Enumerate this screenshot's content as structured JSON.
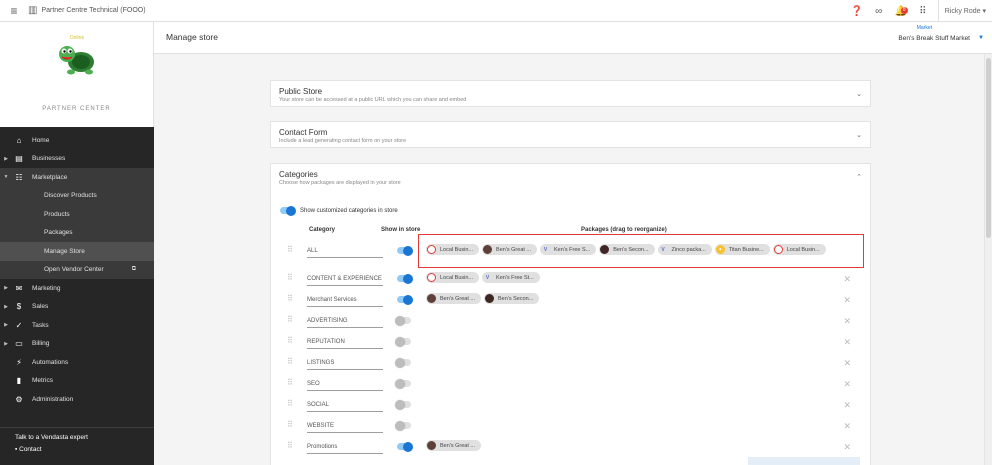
{
  "topbar": {
    "org_title": "Partner Centre Technical (FOOO)",
    "notifications_count": "8",
    "user_name": "Ricky Rode"
  },
  "sidebar": {
    "brand_text": "PARTNER CENTER",
    "logo_text": "Online",
    "items": [
      {
        "label": "Home",
        "icon": "home-icon"
      },
      {
        "label": "Businesses",
        "icon": "businesses-icon"
      },
      {
        "label": "Marketplace",
        "icon": "grid-icon"
      }
    ],
    "marketplace_sub": [
      {
        "label": "Discover Products"
      },
      {
        "label": "Products"
      },
      {
        "label": "Packages"
      },
      {
        "label": "Manage Store"
      },
      {
        "label": "Open Vendor Center"
      }
    ],
    "items_after": [
      {
        "label": "Marketing",
        "icon": "mail-icon"
      },
      {
        "label": "Sales",
        "icon": "dollar-icon"
      },
      {
        "label": "Tasks",
        "icon": "check-circle-icon"
      },
      {
        "label": "Billing",
        "icon": "billing-icon"
      },
      {
        "label": "Automations",
        "icon": "automation-icon"
      },
      {
        "label": "Metrics",
        "icon": "bar-chart-icon"
      },
      {
        "label": "Administration",
        "icon": "gear-icon"
      }
    ],
    "footer": {
      "expert": "Talk to a Vendasta expert",
      "contact": "Contact"
    }
  },
  "header": {
    "title": "Manage store",
    "market_label": "Market",
    "market_value": "Ben's Break Stuff Market"
  },
  "panels": {
    "public_store": {
      "title": "Public Store",
      "subtitle": "Your store can be accessed at a public URL which you can share and embed"
    },
    "contact_form": {
      "title": "Contact Form",
      "subtitle": "Include a lead generating contact form on your store"
    },
    "categories": {
      "title": "Categories",
      "subtitle": "Choose how packages are displayed in your store",
      "show_custom_label": "Show customized categories in store",
      "col_category": "Category",
      "col_show": "Show in store",
      "col_packages": "Packages (drag to reorganize)",
      "rows": [
        {
          "name": "ALL",
          "on": true,
          "chips": [
            {
              "label": "Local Busin...",
              "icon": "red"
            },
            {
              "label": "Ben's Great ...",
              "icon": "dark"
            },
            {
              "label": "Ken's Free S...",
              "icon": "v"
            },
            {
              "label": "Ben's Secon...",
              "icon": "dark2"
            },
            {
              "label": "Zinco packa...",
              "icon": "v"
            },
            {
              "label": "Titan Busine...",
              "icon": "yellow"
            },
            {
              "label": "Local Busin...",
              "icon": "red"
            }
          ]
        },
        {
          "name": "CONTENT & EXPERIENCE",
          "on": true,
          "chips": [
            {
              "label": "Local Busin...",
              "icon": "red"
            },
            {
              "label": "Ken's Free St...",
              "icon": "v"
            }
          ]
        },
        {
          "name": "Merchant Services",
          "on": true,
          "chips": [
            {
              "label": "Ben's Great ...",
              "icon": "dark"
            },
            {
              "label": "Ben's Secon...",
              "icon": "dark2"
            }
          ]
        },
        {
          "name": "ADVERTISING",
          "on": false,
          "chips": []
        },
        {
          "name": "REPUTATION",
          "on": false,
          "chips": []
        },
        {
          "name": "LISTINGS",
          "on": false,
          "chips": []
        },
        {
          "name": "SEO",
          "on": false,
          "chips": []
        },
        {
          "name": "SOCIAL",
          "on": false,
          "chips": []
        },
        {
          "name": "WEBSITE",
          "on": false,
          "chips": []
        },
        {
          "name": "Promotions",
          "on": true,
          "chips": [
            {
              "label": "Ben's Great ...",
              "icon": "dark"
            }
          ]
        }
      ]
    }
  },
  "colors": {
    "accent": "#1976d2",
    "sidebar_bg": "#262626",
    "highlight": "#e53935"
  }
}
